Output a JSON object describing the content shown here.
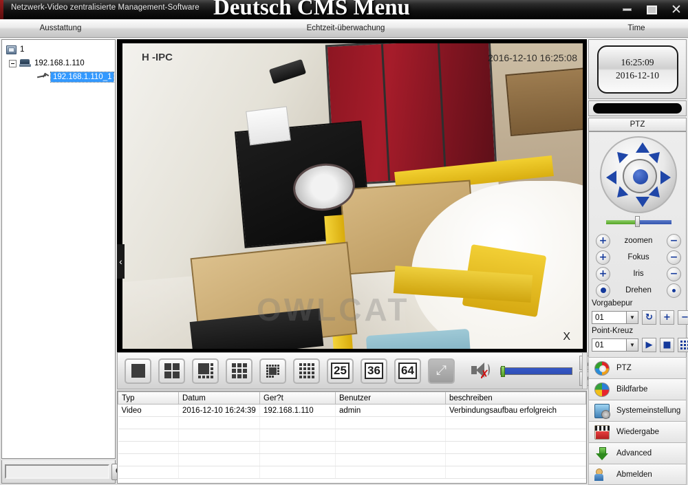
{
  "window": {
    "subtitle": "Netzwerk-Video zentralisierte Management-Software",
    "title": "Deutsch CMS Menu",
    "minimize": "minimize-icon",
    "maximize": "maximize-icon",
    "close": "✕"
  },
  "tabs": [
    {
      "label": "Ausstattung"
    },
    {
      "label": "Echtzeit-überwachung"
    },
    {
      "label": "Time"
    }
  ],
  "sidebar": {
    "tree": [
      {
        "label": "1",
        "level": 1,
        "icon": "group-icon",
        "selected": false
      },
      {
        "label": "192.168.1.110",
        "level": 2,
        "icon": "device-icon",
        "selected": false
      },
      {
        "label": "192.168.1.110_1",
        "level": 3,
        "icon": "camera-icon",
        "selected": true
      }
    ],
    "search_value": "",
    "search_placeholder": "",
    "search_button": "⌕",
    "refresh_button": "↻"
  },
  "video": {
    "osd_left": "H  -IPC",
    "osd_time": "2016-12-10 16:25:08",
    "watermark": "OWLCAT",
    "close_marker": "X",
    "collapse_marker": "‹"
  },
  "controlbar": {
    "layouts": [
      {
        "name": "layout-1",
        "cells": 1,
        "label": ""
      },
      {
        "name": "layout-4",
        "cells": 4,
        "label": ""
      },
      {
        "name": "layout-6",
        "cells": 6,
        "label": ""
      },
      {
        "name": "layout-9",
        "cells": 9,
        "label": ""
      },
      {
        "name": "layout-8",
        "cells": 8,
        "label": ""
      },
      {
        "name": "layout-16",
        "cells": 16,
        "label": ""
      },
      {
        "name": "layout-25",
        "cells": 25,
        "label": "25"
      },
      {
        "name": "layout-36",
        "cells": 36,
        "label": "36"
      },
      {
        "name": "layout-64",
        "cells": 64,
        "label": "64"
      }
    ],
    "fullscreen_icon": "⤢",
    "mute_icon": "speaker-muted-icon",
    "volume_value": 0,
    "scroll_up": "▲",
    "scroll_down": "▼"
  },
  "log": {
    "columns": [
      "Typ",
      "Datum",
      "Ger?t",
      "Benutzer",
      "beschreiben"
    ],
    "rows": [
      {
        "typ": "Video",
        "datum": "2016-12-10 16:24:39",
        "geraet": "192.168.1.110",
        "benutzer": "admin",
        "beschreiben": "Verbindungsaufbau erfolgreich"
      }
    ]
  },
  "right": {
    "time": {
      "clock": "16:25:09",
      "date": "2016-12-10"
    },
    "ptz_header": "PTZ",
    "ptz_controls": [
      {
        "label": "zoomen",
        "plus": "+",
        "minus": "−"
      },
      {
        "label": "Fokus",
        "plus": "+",
        "minus": "−"
      },
      {
        "label": "Iris",
        "plus": "+",
        "minus": "−"
      },
      {
        "label": "Drehen",
        "plus": "•",
        "minus": "•"
      }
    ],
    "preset": {
      "label": "Vorgabepur",
      "value": "01",
      "buttons": [
        "↻",
        "+",
        "−"
      ]
    },
    "cruise": {
      "label": "Point-Kreuz",
      "value": "01",
      "buttons": [
        "▶",
        "■",
        "▦"
      ]
    },
    "menu": [
      {
        "label": "PTZ",
        "icon": "ptz-icon"
      },
      {
        "label": "Bildfarbe",
        "icon": "color-wheel-icon"
      },
      {
        "label": "Systemeinstellung",
        "icon": "system-settings-icon"
      },
      {
        "label": "Wiedergabe",
        "icon": "playback-icon"
      },
      {
        "label": "Advanced",
        "icon": "advanced-arrow-icon"
      },
      {
        "label": "Abmelden",
        "icon": "logout-user-icon"
      }
    ]
  },
  "colors": {
    "accent": "#14399b",
    "selection": "#3399ff",
    "titlebar": "#101010"
  }
}
